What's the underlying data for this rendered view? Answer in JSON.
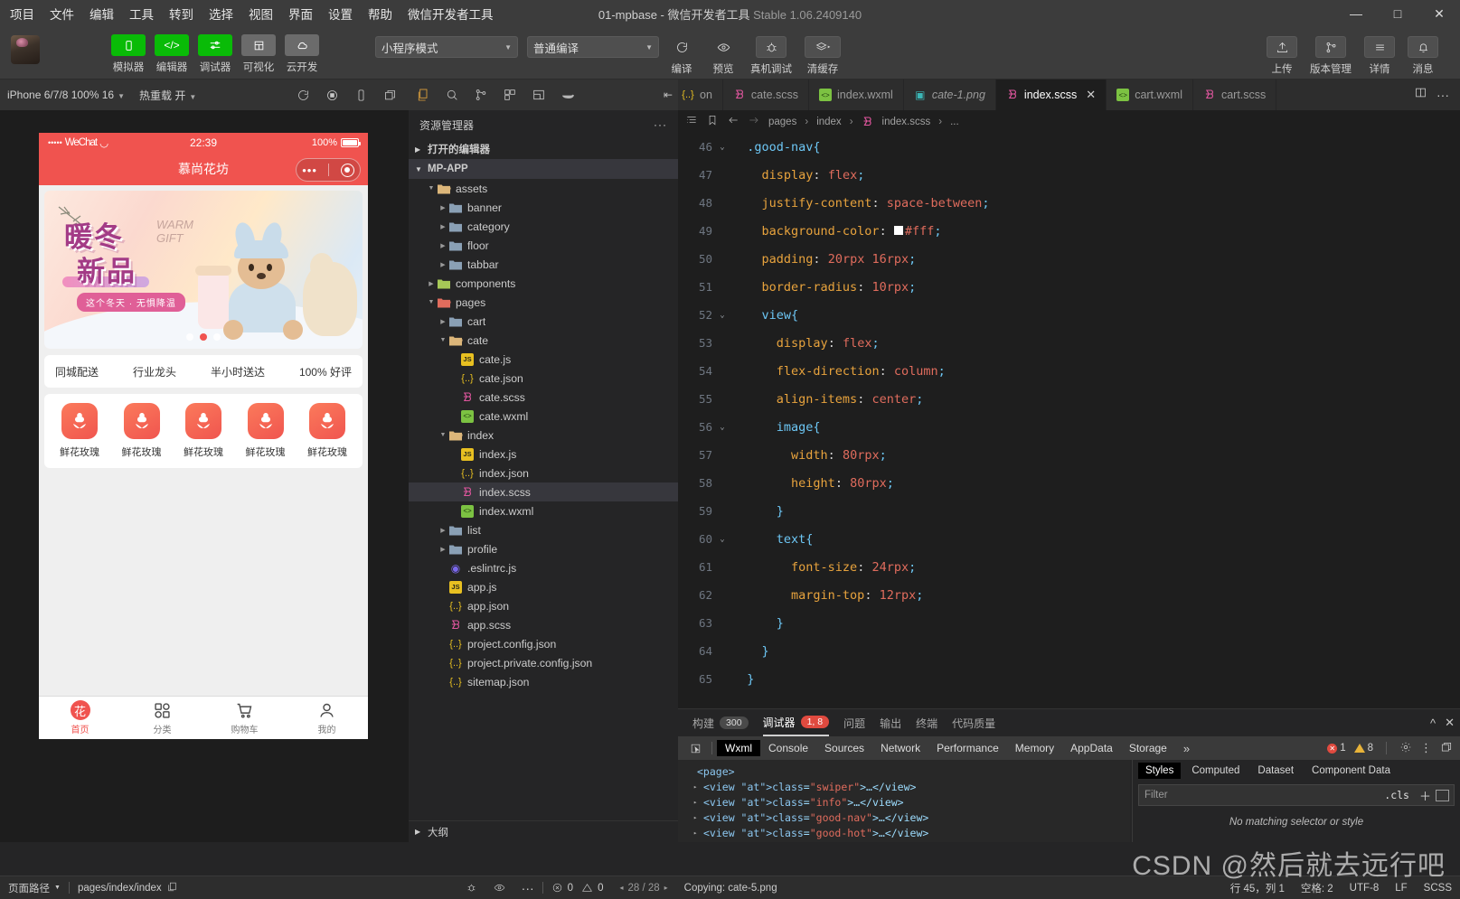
{
  "window": {
    "title_main": "01-mpbase  -  微信开发者工具",
    "title_version": "Stable 1.06.2409140",
    "minimize": "—",
    "maximize": "□",
    "close": "✕"
  },
  "menubar": {
    "items": [
      "项目",
      "文件",
      "编辑",
      "工具",
      "转到",
      "选择",
      "视图",
      "界面",
      "设置",
      "帮助",
      "微信开发者工具"
    ]
  },
  "toolbar": {
    "left_buttons": [
      {
        "label": "模拟器",
        "icon": "phone-icon",
        "style": "green"
      },
      {
        "label": "编辑器",
        "icon": "code-icon",
        "style": "green"
      },
      {
        "label": "调试器",
        "icon": "sliders-icon",
        "style": "green"
      },
      {
        "label": "可视化",
        "icon": "layout-icon",
        "style": "grey"
      },
      {
        "label": "云开发",
        "icon": "cloud-icon",
        "style": "grey"
      }
    ],
    "mode_select": "小程序模式",
    "compile_select": "普通编译",
    "center_buttons": [
      {
        "label": "编译",
        "icon": "refresh-icon"
      },
      {
        "label": "预览",
        "icon": "eye-icon"
      },
      {
        "label": "真机调试",
        "icon": "bug-icon"
      },
      {
        "label": "清缓存",
        "icon": "layers-icon"
      }
    ],
    "right_buttons": [
      {
        "label": "上传",
        "icon": "upload-icon"
      },
      {
        "label": "版本管理",
        "icon": "branch-icon"
      },
      {
        "label": "详情",
        "icon": "menu-icon"
      },
      {
        "label": "消息",
        "icon": "bell-icon"
      }
    ]
  },
  "simulator_toolbar": {
    "device": "iPhone 6/7/8 100% 16",
    "hotreload_label": "热重载",
    "hotreload_value": "开",
    "icons": [
      "refresh-icon",
      "record-icon",
      "rotate-icon",
      "window-icon"
    ]
  },
  "explorer_toolbar": {
    "icons": [
      "files-icon",
      "search-icon",
      "source-control-icon",
      "extensions-icon",
      "debug-icon",
      "docker-icon"
    ],
    "collapse": "collapse-icon"
  },
  "editor_tabs": [
    {
      "label": "on",
      "icon": "json-icon",
      "active": false,
      "italic": false,
      "partial": true
    },
    {
      "label": "cate.scss",
      "icon": "scss-icon",
      "active": false,
      "italic": false
    },
    {
      "label": "index.wxml",
      "icon": "wxml-icon",
      "active": false,
      "italic": false
    },
    {
      "label": "cate-1.png",
      "icon": "png-icon",
      "active": false,
      "italic": true
    },
    {
      "label": "index.scss",
      "icon": "scss-icon",
      "active": true,
      "italic": false,
      "close": "✕"
    },
    {
      "label": "cart.wxml",
      "icon": "wxml-icon",
      "active": false,
      "italic": false
    },
    {
      "label": "cart.scss",
      "icon": "scss-icon",
      "active": false,
      "italic": false
    }
  ],
  "editor_tab_actions": [
    "split-editor-icon",
    "more-icon"
  ],
  "breadcrumb": {
    "icons": [
      "outline-icon",
      "bookmark-icon",
      "back-icon",
      "forward-icon"
    ],
    "parts": [
      "pages",
      "index",
      "index.scss",
      "..."
    ]
  },
  "explorer": {
    "title": "资源管理器",
    "more": "···",
    "open_editors": "打开的编辑器",
    "project": "MP-APP",
    "outline": "大纲",
    "tree": [
      {
        "label": "assets",
        "depth": 1,
        "type": "folder-open",
        "arrow": "down",
        "color": "#dcb67a"
      },
      {
        "label": "banner",
        "depth": 2,
        "type": "folder",
        "arrow": "right",
        "color": "#8aa0b5"
      },
      {
        "label": "category",
        "depth": 2,
        "type": "folder",
        "arrow": "right",
        "color": "#8aa0b5"
      },
      {
        "label": "floor",
        "depth": 2,
        "type": "folder",
        "arrow": "right",
        "color": "#8aa0b5"
      },
      {
        "label": "tabbar",
        "depth": 2,
        "type": "folder",
        "arrow": "right",
        "color": "#8aa0b5"
      },
      {
        "label": "components",
        "depth": 1,
        "type": "folder",
        "arrow": "right",
        "color": "#a7c957"
      },
      {
        "label": "pages",
        "depth": 1,
        "type": "folder-open",
        "arrow": "down",
        "color": "#e06c5d"
      },
      {
        "label": "cart",
        "depth": 2,
        "type": "folder",
        "arrow": "right",
        "color": "#8aa0b5"
      },
      {
        "label": "cate",
        "depth": 2,
        "type": "folder-open",
        "arrow": "down",
        "color": "#dcb67a"
      },
      {
        "label": "cate.js",
        "depth": 3,
        "type": "js",
        "arrow": "none"
      },
      {
        "label": "cate.json",
        "depth": 3,
        "type": "json",
        "arrow": "none"
      },
      {
        "label": "cate.scss",
        "depth": 3,
        "type": "scss",
        "arrow": "none"
      },
      {
        "label": "cate.wxml",
        "depth": 3,
        "type": "wxml",
        "arrow": "none"
      },
      {
        "label": "index",
        "depth": 2,
        "type": "folder-open",
        "arrow": "down",
        "color": "#dcb67a"
      },
      {
        "label": "index.js",
        "depth": 3,
        "type": "js",
        "arrow": "none"
      },
      {
        "label": "index.json",
        "depth": 3,
        "type": "json",
        "arrow": "none"
      },
      {
        "label": "index.scss",
        "depth": 3,
        "type": "scss",
        "arrow": "none",
        "selected": true
      },
      {
        "label": "index.wxml",
        "depth": 3,
        "type": "wxml",
        "arrow": "none"
      },
      {
        "label": "list",
        "depth": 2,
        "type": "folder",
        "arrow": "right",
        "color": "#8aa0b5"
      },
      {
        "label": "profile",
        "depth": 2,
        "type": "folder",
        "arrow": "right",
        "color": "#8aa0b5"
      },
      {
        "label": ".eslintrc.js",
        "depth": 2,
        "type": "eslint",
        "arrow": "none"
      },
      {
        "label": "app.js",
        "depth": 2,
        "type": "js",
        "arrow": "none"
      },
      {
        "label": "app.json",
        "depth": 2,
        "type": "json",
        "arrow": "none"
      },
      {
        "label": "app.scss",
        "depth": 2,
        "type": "scss",
        "arrow": "none"
      },
      {
        "label": "project.config.json",
        "depth": 2,
        "type": "json",
        "arrow": "none"
      },
      {
        "label": "project.private.config.json",
        "depth": 2,
        "type": "json",
        "arrow": "none"
      },
      {
        "label": "sitemap.json",
        "depth": 2,
        "type": "json",
        "arrow": "none"
      }
    ]
  },
  "code_lines": [
    {
      "n": 46,
      "fold": "v",
      "indent": 0,
      "tokens": [
        {
          "t": ".good-nav",
          "c": "sel"
        },
        {
          "t": "{",
          "c": "brace"
        }
      ]
    },
    {
      "n": 47,
      "fold": "",
      "indent": 1,
      "tokens": [
        {
          "t": "display",
          "c": "prop"
        },
        {
          "t": ": ",
          "c": "punc"
        },
        {
          "t": "flex",
          "c": "val"
        },
        {
          "t": ";",
          "c": "brace"
        }
      ]
    },
    {
      "n": 48,
      "fold": "",
      "indent": 1,
      "tokens": [
        {
          "t": "justify-content",
          "c": "prop"
        },
        {
          "t": ": ",
          "c": "punc"
        },
        {
          "t": "space-between",
          "c": "val"
        },
        {
          "t": ";",
          "c": "brace"
        }
      ]
    },
    {
      "n": 49,
      "fold": "",
      "indent": 1,
      "swatch": true,
      "tokens": [
        {
          "t": "background-color",
          "c": "prop"
        },
        {
          "t": ": ",
          "c": "punc"
        },
        {
          "t": "#fff",
          "c": "val"
        },
        {
          "t": ";",
          "c": "brace"
        }
      ]
    },
    {
      "n": 50,
      "fold": "",
      "indent": 1,
      "tokens": [
        {
          "t": "padding",
          "c": "prop"
        },
        {
          "t": ": ",
          "c": "punc"
        },
        {
          "t": "20rpx 16rpx",
          "c": "val"
        },
        {
          "t": ";",
          "c": "brace"
        }
      ]
    },
    {
      "n": 51,
      "fold": "",
      "indent": 1,
      "tokens": [
        {
          "t": "border-radius",
          "c": "prop"
        },
        {
          "t": ": ",
          "c": "punc"
        },
        {
          "t": "10rpx",
          "c": "val"
        },
        {
          "t": ";",
          "c": "brace"
        }
      ]
    },
    {
      "n": 52,
      "fold": "v",
      "indent": 1,
      "tokens": [
        {
          "t": "view",
          "c": "sel"
        },
        {
          "t": "{",
          "c": "brace"
        }
      ]
    },
    {
      "n": 53,
      "fold": "",
      "indent": 2,
      "tokens": [
        {
          "t": "display",
          "c": "prop"
        },
        {
          "t": ": ",
          "c": "punc"
        },
        {
          "t": "flex",
          "c": "val"
        },
        {
          "t": ";",
          "c": "brace"
        }
      ]
    },
    {
      "n": 54,
      "fold": "",
      "indent": 2,
      "tokens": [
        {
          "t": "flex-direction",
          "c": "prop"
        },
        {
          "t": ": ",
          "c": "punc"
        },
        {
          "t": "column",
          "c": "val"
        },
        {
          "t": ";",
          "c": "brace"
        }
      ]
    },
    {
      "n": 55,
      "fold": "",
      "indent": 2,
      "tokens": [
        {
          "t": "align-items",
          "c": "prop"
        },
        {
          "t": ": ",
          "c": "punc"
        },
        {
          "t": "center",
          "c": "val"
        },
        {
          "t": ";",
          "c": "brace"
        }
      ]
    },
    {
      "n": 56,
      "fold": "v",
      "indent": 2,
      "tokens": [
        {
          "t": "image",
          "c": "sel"
        },
        {
          "t": "{",
          "c": "brace"
        }
      ]
    },
    {
      "n": 57,
      "fold": "",
      "indent": 3,
      "tokens": [
        {
          "t": "width",
          "c": "prop"
        },
        {
          "t": ": ",
          "c": "punc"
        },
        {
          "t": "80rpx",
          "c": "val"
        },
        {
          "t": ";",
          "c": "brace"
        }
      ]
    },
    {
      "n": 58,
      "fold": "",
      "indent": 3,
      "tokens": [
        {
          "t": "height",
          "c": "prop"
        },
        {
          "t": ": ",
          "c": "punc"
        },
        {
          "t": "80rpx",
          "c": "val"
        },
        {
          "t": ";",
          "c": "brace"
        }
      ]
    },
    {
      "n": 59,
      "fold": "",
      "indent": 2,
      "tokens": [
        {
          "t": "}",
          "c": "brace"
        }
      ]
    },
    {
      "n": 60,
      "fold": "v",
      "indent": 2,
      "tokens": [
        {
          "t": "text",
          "c": "sel"
        },
        {
          "t": "{",
          "c": "brace"
        }
      ]
    },
    {
      "n": 61,
      "fold": "",
      "indent": 3,
      "tokens": [
        {
          "t": "font-size",
          "c": "prop"
        },
        {
          "t": ": ",
          "c": "punc"
        },
        {
          "t": "24rpx",
          "c": "val"
        },
        {
          "t": ";",
          "c": "brace"
        }
      ]
    },
    {
      "n": 62,
      "fold": "",
      "indent": 3,
      "tokens": [
        {
          "t": "margin-top",
          "c": "prop"
        },
        {
          "t": ": ",
          "c": "punc"
        },
        {
          "t": "12rpx",
          "c": "val"
        },
        {
          "t": ";",
          "c": "brace"
        }
      ]
    },
    {
      "n": 63,
      "fold": "",
      "indent": 2,
      "tokens": [
        {
          "t": "}",
          "c": "brace"
        }
      ]
    },
    {
      "n": 64,
      "fold": "",
      "indent": 1,
      "tokens": [
        {
          "t": "}",
          "c": "brace"
        }
      ]
    },
    {
      "n": 65,
      "fold": "",
      "indent": 0,
      "tokens": [
        {
          "t": "}",
          "c": "brace"
        }
      ]
    }
  ],
  "phone": {
    "status": {
      "carrier": "WeChat",
      "dots": "•••••",
      "wifi": "᯼",
      "time": "22:39",
      "battery_pct": "100%"
    },
    "nav_title": "慕尚花坊",
    "capsule": {
      "dots": "•••",
      "circle": "◉"
    },
    "banner": {
      "title_line1": "暖冬",
      "title_line2": "新品",
      "sub_en_1": "WARM",
      "sub_en_2": "GIFT",
      "tagline": "这个冬天 · 无惧降温"
    },
    "banner_dots": [
      false,
      true,
      false
    ],
    "info_items": [
      "同城配送",
      "行业龙头",
      "半小时送达",
      "100% 好评"
    ],
    "good_nav": [
      {
        "name": "鲜花玫瑰"
      },
      {
        "name": "鲜花玫瑰"
      },
      {
        "name": "鲜花玫瑰"
      },
      {
        "name": "鲜花玫瑰"
      },
      {
        "name": "鲜花玫瑰"
      }
    ],
    "tabbar": [
      {
        "label": "首页",
        "icon": "flower-icon",
        "active": true
      },
      {
        "label": "分类",
        "icon": "grid-icon",
        "active": false
      },
      {
        "label": "购物车",
        "icon": "cart-icon",
        "active": false
      },
      {
        "label": "我的",
        "icon": "user-icon",
        "active": false
      }
    ]
  },
  "bottom_panel": {
    "tabs": [
      {
        "label": "构建",
        "badge": "300",
        "badge_style": "grey",
        "active": false
      },
      {
        "label": "调试器",
        "badge": "1, 8",
        "badge_style": "red",
        "active": true
      },
      {
        "label": "问题",
        "badge": "",
        "active": false
      },
      {
        "label": "输出",
        "badge": "",
        "active": false
      },
      {
        "label": "终端",
        "badge": "",
        "active": false
      },
      {
        "label": "代码质量",
        "badge": "",
        "active": false
      }
    ],
    "collapse": "^",
    "close": "✕",
    "devtools_tabs": [
      "Wxml",
      "Console",
      "Sources",
      "Network",
      "Performance",
      "Memory",
      "AppData",
      "Storage"
    ],
    "devtools_active": "Wxml",
    "devtools_overflow": "»",
    "error_count": "1",
    "warning_count": "8",
    "wxml_tree": [
      {
        "indent": 0,
        "arrow": "",
        "text": "<page>"
      },
      {
        "indent": 1,
        "arrow": "▸",
        "text": "<view class=\"swiper\">…</view>"
      },
      {
        "indent": 1,
        "arrow": "▸",
        "text": "<view class=\"info\">…</view>"
      },
      {
        "indent": 1,
        "arrow": "▸",
        "text": "<view class=\"good-nav\">…</view>"
      },
      {
        "indent": 1,
        "arrow": "▸",
        "text": "<view class=\"good-hot\">…</view>"
      }
    ],
    "styles_tabs": [
      "Styles",
      "Computed",
      "Dataset",
      "Component Data"
    ],
    "styles_active": "Styles",
    "filter_placeholder": "Filter",
    "cls_label": ".cls",
    "no_match": "No matching selector or style"
  },
  "statusbar": {
    "page_path_label": "页面路径",
    "page_path_value": "pages/index/index",
    "copy_icon": "copy-icon",
    "left_icons": [
      "bug-icon",
      "eye-icon",
      "more-icon"
    ],
    "errors": "0",
    "warnings": "0",
    "progress": "28 / 28",
    "copying": "Copying: cate-5.png",
    "cursor": "行 45，列 1",
    "indent": "空格: 2",
    "encoding": "UTF-8",
    "eol": "LF",
    "language": "SCSS"
  },
  "watermark": "CSDN @然后就去远行吧"
}
